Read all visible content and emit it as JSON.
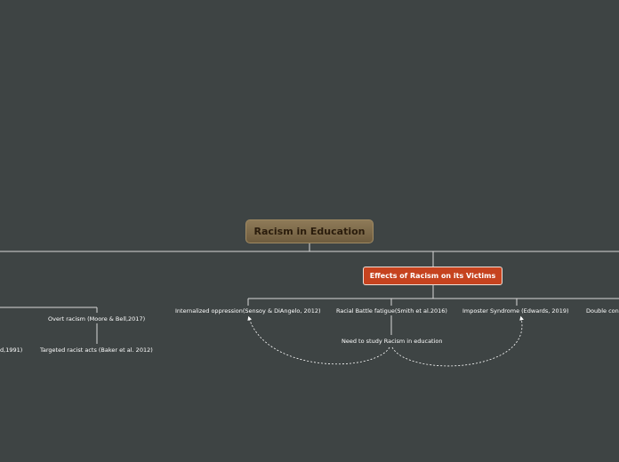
{
  "root": {
    "label": "Racism in Education"
  },
  "main_branch": {
    "label": "Effects of Racism on its Victims"
  },
  "effects": [
    {
      "label": "Internalized oppression(Sensoy & DiAngelo, 2012)"
    },
    {
      "label": "Racial Battle fatigue(Smith et al.2016)"
    },
    {
      "label": "Imposter Syndrome (Edwards, 2019)"
    },
    {
      "label": "Double con"
    }
  ],
  "center_topic": {
    "label": "Need to study Racism in education"
  },
  "left_branch": {
    "overt": {
      "label": "Overt racism (Moore & Bell,2017)"
    },
    "targeted": {
      "label": "Targeted racist acts (Baker et al. 2012)"
    },
    "cut_item": {
      "label": "d,1991)"
    }
  },
  "colors": {
    "background": "#3e4444",
    "connector": "#d8d8d8",
    "main_node": "#c6431f",
    "root_node": "#7e6a4a"
  }
}
